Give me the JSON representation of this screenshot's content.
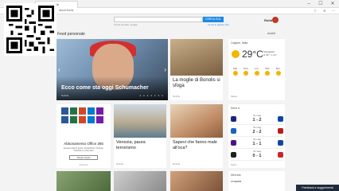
{
  "browser": {
    "tab_title": "Pagina iniziale",
    "address": "about:home",
    "window_controls": [
      "–",
      "☐",
      "✕"
    ]
  },
  "search": {
    "placeholder": "",
    "button_label": "CERCA SUL WEB",
    "powered_by": "Cerca sul web: google",
    "link": "Cerca in questo sito"
  },
  "user": {
    "name": "Rubbe"
  },
  "feed": {
    "title": "Feed personale",
    "settings_label": "accedi"
  },
  "hero": {
    "headline": "Ecco come sta oggi Schumacher",
    "source": "Notizie",
    "dots": "● ● ● ● ● ● ●"
  },
  "story2": {
    "title": "La moglie di Bonolis si sfoga",
    "source": "Notizie"
  },
  "weather": {
    "city": "Cagliari, Italia",
    "temp": "29°C",
    "condition": "Soleggiato",
    "details": "H 32° / L 21°",
    "days": [
      {
        "d": "Sab"
      },
      {
        "d": "Dom"
      },
      {
        "d": "Lun"
      },
      {
        "d": "Mar"
      },
      {
        "d": "Mer"
      }
    ],
    "foot": "Meteo"
  },
  "office": {
    "title": "Abbonamento Office 365",
    "description": "Accedi a Word, Excel, PowerPoint, Outlook, OneNote e molto altro",
    "button": "Scopri di più",
    "foot": "Annuncio",
    "tile_colors": [
      "#2b579a",
      "#217346",
      "#d24726",
      "#0078d4",
      "#7719aa",
      "#2b579a",
      "#217346",
      "#d24726",
      "#0078d4",
      "#7719aa"
    ]
  },
  "story3": {
    "title": "Venezia, paura terrorismo",
    "source": "Notizie"
  },
  "story4": {
    "title": "Sapevi che fanno male all'oca?",
    "source": "Notizie"
  },
  "serie_a": {
    "title": "Serie A",
    "matches": [
      {
        "date": "31 mag",
        "score": "1 - 2",
        "home_color": "#1a237e",
        "away_color": "#0d47a1"
      },
      {
        "date": "31 mag",
        "score": "2 - 2",
        "home_color": "#1565c0",
        "away_color": "#b71c1c"
      },
      {
        "date": "31 mag",
        "score": "1 - 1",
        "home_color": "#4a148c",
        "away_color": "#0d47a1"
      },
      {
        "date": "31 mag",
        "score": "0 - 1",
        "home_color": "#212121",
        "away_color": "#c62828"
      }
    ],
    "foot": "Sport"
  },
  "market": {
    "title": "Mercato",
    "value": "FTSEMIB"
  },
  "feedback": {
    "label": "Feedback e suggerimenti"
  }
}
